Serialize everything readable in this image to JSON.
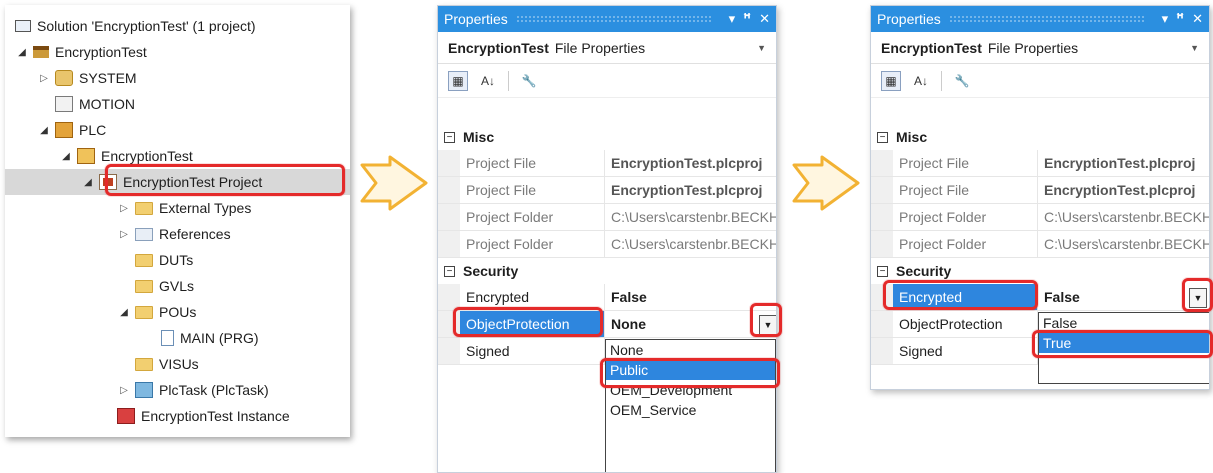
{
  "tree": {
    "items": [
      {
        "label": "Solution 'EncryptionTest' (1 project)",
        "icon": "solution-icon"
      },
      {
        "label": "EncryptionTest",
        "icon": "project-icon"
      },
      {
        "label": "SYSTEM",
        "icon": "system-icon"
      },
      {
        "label": "MOTION",
        "icon": "motion-icon"
      },
      {
        "label": "PLC",
        "icon": "plc-icon"
      },
      {
        "label": "EncryptionTest",
        "icon": "plc-project-icon"
      },
      {
        "label": "EncryptionTest Project",
        "icon": "plc-project-file-icon"
      },
      {
        "label": "External Types",
        "icon": "folder-icon"
      },
      {
        "label": "References",
        "icon": "references-icon"
      },
      {
        "label": "DUTs",
        "icon": "folder-icon"
      },
      {
        "label": "GVLs",
        "icon": "folder-icon"
      },
      {
        "label": "POUs",
        "icon": "folder-open-icon"
      },
      {
        "label": "MAIN (PRG)",
        "icon": "program-icon"
      },
      {
        "label": "VISUs",
        "icon": "folder-icon"
      },
      {
        "label": "PlcTask (PlcTask)",
        "icon": "task-icon"
      },
      {
        "label": "EncryptionTest Instance",
        "icon": "instance-icon"
      }
    ]
  },
  "panel1": {
    "title": "Properties",
    "object_name": "EncryptionTest",
    "object_type": "File Properties",
    "categories": {
      "misc": "Misc",
      "security": "Security"
    },
    "misc_rows": [
      {
        "name": "Project File",
        "value": "EncryptionTest.plcproj"
      },
      {
        "name": "Project File",
        "value": "EncryptionTest.plcproj"
      },
      {
        "name": "Project Folder",
        "value": "C:\\Users\\carstenbr.BECKHOFF"
      },
      {
        "name": "Project Folder",
        "value": "C:\\Users\\carstenbr.BECKHOFF"
      }
    ],
    "security_rows": [
      {
        "name": "Encrypted",
        "value": "False"
      },
      {
        "name": "ObjectProtection",
        "value": "None"
      },
      {
        "name": "Signed",
        "value": ""
      }
    ],
    "dropdown_options": [
      "None",
      "Public",
      "OEM_Development",
      "OEM_Service"
    ],
    "highlighted_option": "Public"
  },
  "panel2": {
    "title": "Properties",
    "object_name": "EncryptionTest",
    "object_type": "File Properties",
    "categories": {
      "misc": "Misc",
      "security": "Security"
    },
    "misc_rows": [
      {
        "name": "Project File",
        "value": "EncryptionTest.plcproj"
      },
      {
        "name": "Project File",
        "value": "EncryptionTest.plcproj"
      },
      {
        "name": "Project Folder",
        "value": "C:\\Users\\carstenbr.BECKHOFF"
      },
      {
        "name": "Project Folder",
        "value": "C:\\Users\\carstenbr.BECKHOFF"
      }
    ],
    "security_rows": [
      {
        "name": "Encrypted",
        "value": "False"
      },
      {
        "name": "ObjectProtection",
        "value": ""
      },
      {
        "name": "Signed",
        "value": ""
      }
    ],
    "dropdown_options": [
      "False",
      "True"
    ],
    "highlighted_option": "True"
  },
  "colors": {
    "highlight": "#e42a2a",
    "selection": "#2e86de",
    "arrow": "#f2b233",
    "title_bar": "#2b8fe0"
  }
}
